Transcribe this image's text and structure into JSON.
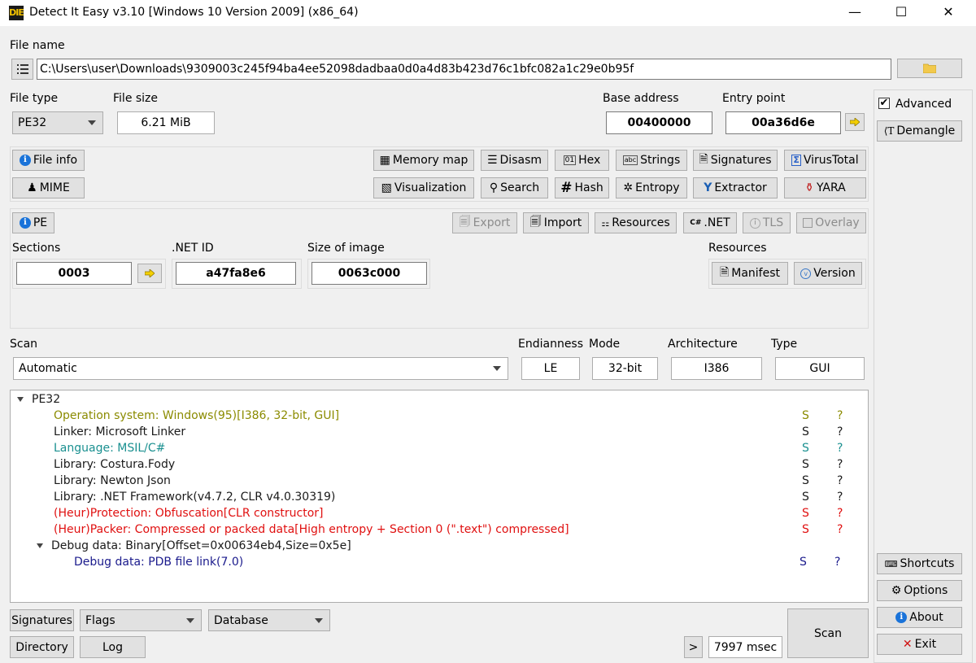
{
  "window": {
    "title": "Detect It Easy v3.10 [Windows 10 Version 2009] (x86_64)",
    "logo": "DIE",
    "minimize_glyph": "—",
    "maximize_glyph": "☐",
    "close_glyph": "✕"
  },
  "file": {
    "label": "File name",
    "path": "C:\\Users\\user\\Downloads\\9309003c245f94ba4ee52098dadbaa0d0a4d83b423d76c1bfc082a1c29e0b95f",
    "list_icon": "list-icon",
    "browse_icon": "folder-icon"
  },
  "header": {
    "file_type_label": "File type",
    "file_type_value": "PE32",
    "file_size_label": "File size",
    "file_size_value": "6.21 MiB",
    "base_address_label": "Base address",
    "base_address_value": "00400000",
    "entry_point_label": "Entry point",
    "entry_point_value": "00a36d6e"
  },
  "side": {
    "advanced_label": "Advanced",
    "advanced_checked": true,
    "check_glyph": "✔",
    "demangle_label": "Demangle",
    "shortcuts_label": "Shortcuts",
    "options_label": "Options",
    "about_label": "About",
    "exit_label": "Exit"
  },
  "toolbar": {
    "file_info": "File info",
    "mime": "MIME",
    "memory_map": "Memory map",
    "disasm": "Disasm",
    "hex": "Hex",
    "strings": "Strings",
    "signatures": "Signatures",
    "virustotal": "VirusTotal",
    "visualization": "Visualization",
    "search": "Search",
    "hash": "Hash",
    "entropy": "Entropy",
    "extractor": "Extractor",
    "yara": "YARA"
  },
  "pe": {
    "pe_button": "PE",
    "export": "Export",
    "import": "Import",
    "resources": "Resources",
    "net": ".NET",
    "tls": "TLS",
    "overlay": "Overlay",
    "sections_label": "Sections",
    "sections_value": "0003",
    "net_id_label": ".NET ID",
    "net_id_value": "a47fa8e6",
    "size_of_image_label": "Size of image",
    "size_of_image_value": "0063c000",
    "resources_label": "Resources",
    "manifest": "Manifest",
    "version": "Version"
  },
  "scan": {
    "label": "Scan",
    "mode_value": "Automatic",
    "endianness_label": "Endianness",
    "endianness_value": "LE",
    "mode_label": "Mode",
    "mode_bits": "32-bit",
    "architecture_label": "Architecture",
    "architecture_value": "I386",
    "type_label": "Type",
    "type_value": "GUI"
  },
  "results": {
    "root": "PE32",
    "rows": [
      {
        "text": "Operation system: Windows(95)[I386, 32-bit, GUI]",
        "s": "S",
        "q": "?",
        "kind": "os"
      },
      {
        "text": "Linker: Microsoft Linker",
        "s": "S",
        "q": "?",
        "kind": "norm"
      },
      {
        "text": "Language: MSIL/C#",
        "s": "S",
        "q": "?",
        "kind": "lang"
      },
      {
        "text": "Library: Costura.Fody",
        "s": "S",
        "q": "?",
        "kind": "norm"
      },
      {
        "text": "Library: Newton Json",
        "s": "S",
        "q": "?",
        "kind": "norm"
      },
      {
        "text": "Library: .NET Framework(v4.7.2, CLR v4.0.30319)",
        "s": "S",
        "q": "?",
        "kind": "norm"
      },
      {
        "text": "(Heur)Protection: Obfuscation[CLR constructor]",
        "s": "S",
        "q": "?",
        "kind": "heur"
      },
      {
        "text": "(Heur)Packer: Compressed or packed data[High entropy + Section 0 (\".text\") compressed]",
        "s": "S",
        "q": "?",
        "kind": "heur"
      },
      {
        "text": "Debug data: Binary[Offset=0x00634eb4,Size=0x5e]",
        "s": "",
        "q": "",
        "kind": "norm"
      }
    ],
    "child": {
      "text": "Debug data: PDB file link(7.0)",
      "s": "S",
      "q": "?"
    }
  },
  "bottom": {
    "signatures": "Signatures",
    "flags": "Flags",
    "database": "Database",
    "directory": "Directory",
    "log": "Log",
    "more": ">",
    "time": "7997 msec",
    "scan": "Scan"
  },
  "colors": {
    "os": "#8b8b00",
    "lang": "#1a9090",
    "heur": "#e01010",
    "debug": "#1a1a8c",
    "accent_info": "#1a73d9"
  }
}
